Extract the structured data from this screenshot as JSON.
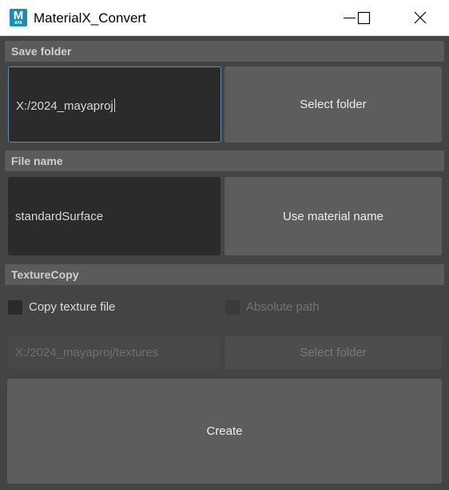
{
  "window": {
    "title": "MaterialX_Convert",
    "icon_letter": "M",
    "icon_sub": "AYA",
    "controls": [
      "minimize-icon",
      "maximize-icon",
      "close-icon"
    ]
  },
  "save_folder": {
    "header": "Save folder",
    "path_value": "X:/2024_mayaproj",
    "select_button": "Select folder"
  },
  "file_name": {
    "header": "File name",
    "name_value": "standardSurface",
    "use_material_button": "Use material name"
  },
  "texture_copy": {
    "header": "TextureCopy",
    "copy_texture_label": "Copy texture file",
    "copy_texture_checked": false,
    "absolute_path_label": "Absolute path",
    "absolute_path_checked": false,
    "texture_path_value": "X:/2024_mayaproj/textures",
    "select_button": "Select folder"
  },
  "create_button": "Create"
}
